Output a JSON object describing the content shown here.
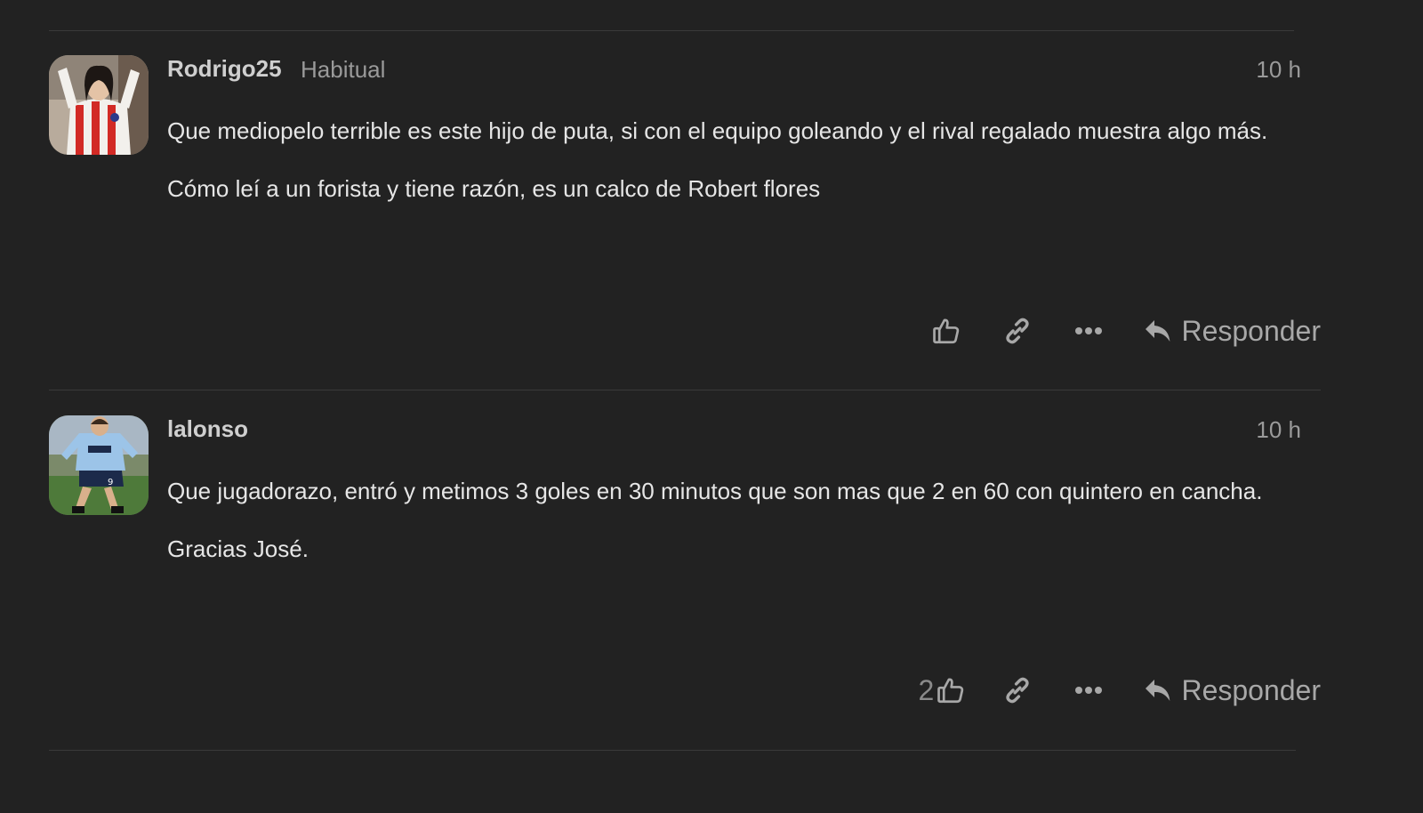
{
  "colors": {
    "background": "#222222",
    "divider": "#3a3a3a",
    "username": "#cfcfcf",
    "muted": "#9a9a9a",
    "body_text": "#e6e6e6",
    "action_icon": "#a8a8a8"
  },
  "posts": [
    {
      "username": "Rodrigo25",
      "user_title": "Habitual",
      "date": "10 h",
      "paragraphs": [
        "Que mediopelo terrible es este hijo de puta, si con el equipo goleando y el rival regalado muestra algo más.",
        "Cómo leí a un forista y tiene razón, es un calco de Robert flores"
      ],
      "like_count": "",
      "avatar": "avatar-red-white-striped-shirt",
      "actions": {
        "like_icon": "thumbs-up-icon",
        "copy_icon": "link-icon",
        "more_icon": "ellipsis-icon",
        "reply_icon": "reply-icon",
        "reply_label": "Responder"
      }
    },
    {
      "username": "lalonso",
      "user_title": "",
      "date": "10 h",
      "paragraphs": [
        "Que jugadorazo, entró y metimos 3 goles en 30 minutos que son mas que 2 en 60 con quintero en cancha.",
        "Gracias José."
      ],
      "like_count": "2",
      "avatar": "avatar-football-player-light-blue-kit",
      "actions": {
        "like_icon": "thumbs-up-icon",
        "copy_icon": "link-icon",
        "more_icon": "ellipsis-icon",
        "reply_icon": "reply-icon",
        "reply_label": "Responder"
      }
    }
  ]
}
